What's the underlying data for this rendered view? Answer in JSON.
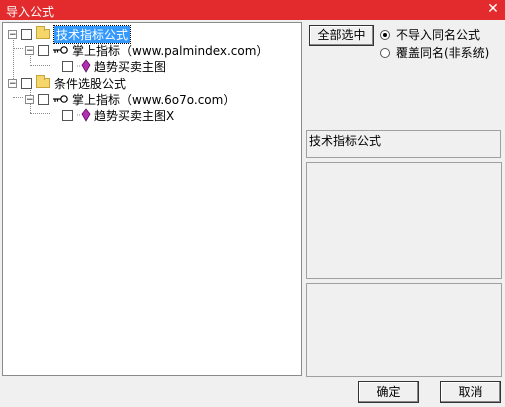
{
  "window": {
    "title": "导入公式",
    "close_glyph": "✕"
  },
  "tree": {
    "groups": [
      {
        "label": "技术指标公式",
        "selected": true,
        "expander": "−",
        "child": {
          "label": "掌上指标（www.palmindex.com）",
          "expander": "−",
          "item": "趋势买卖主图"
        }
      },
      {
        "label": "条件选股公式",
        "selected": false,
        "expander": "−",
        "child": {
          "label": "掌上指标（www.6o7o.com）",
          "expander": "−",
          "item": "趋势买卖主图X"
        }
      }
    ]
  },
  "options": {
    "select_all_label": "全部选中",
    "radio_no_import": "不导入同名公式",
    "radio_overwrite": "覆盖同名(非系统)"
  },
  "info": {
    "formula_type": "技术指标公式"
  },
  "buttons": {
    "ok": "确定",
    "cancel": "取消"
  },
  "colors": {
    "titlebar": "#e32b2d",
    "selection": "#3399ff"
  }
}
